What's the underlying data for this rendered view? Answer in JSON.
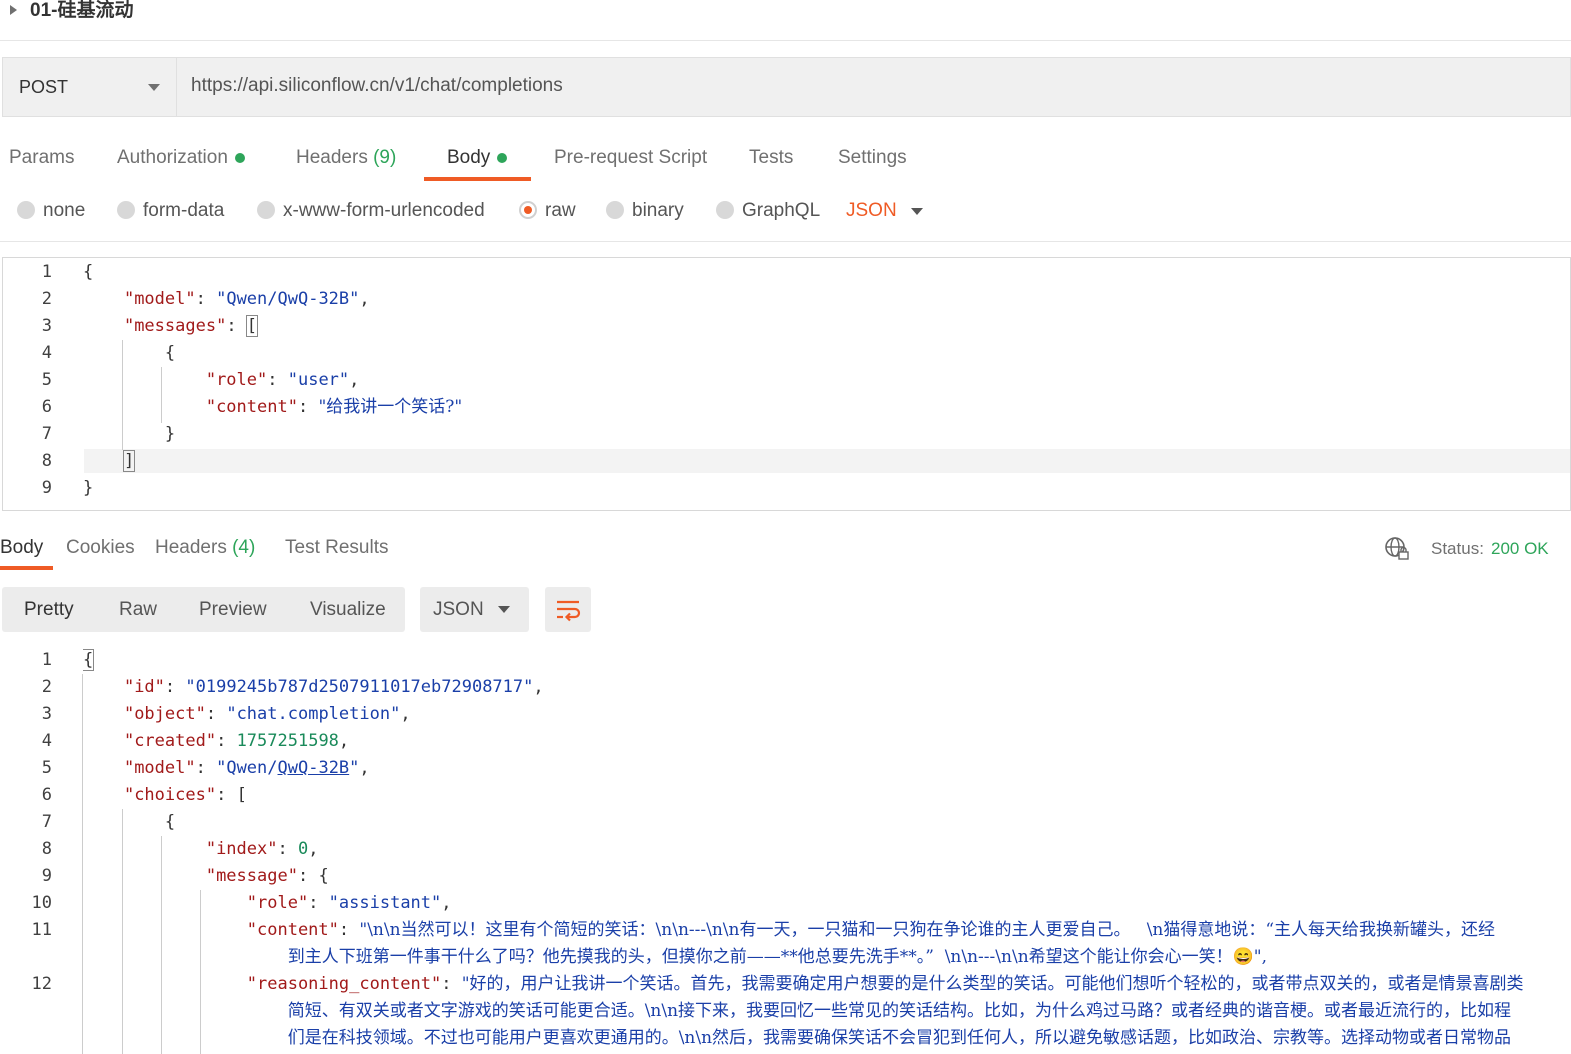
{
  "request": {
    "name": "01-硅基流动",
    "method": "POST",
    "url": "https://api.siliconflow.cn/v1/chat/completions"
  },
  "request_tabs": {
    "params": "Params",
    "authorization": "Authorization",
    "headers": "Headers",
    "headers_count": "(9)",
    "body": "Body",
    "prerequest": "Pre-request Script",
    "tests": "Tests",
    "settings": "Settings"
  },
  "body_types": {
    "none": "none",
    "form_data": "form-data",
    "urlencoded": "x-www-form-urlencoded",
    "raw": "raw",
    "binary": "binary",
    "graphql": "GraphQL",
    "selected_format": "JSON"
  },
  "request_body": {
    "line_numbers": [
      "1",
      "2",
      "3",
      "4",
      "5",
      "6",
      "7",
      "8",
      "9"
    ],
    "open_brace": "{",
    "model_key": "\"model\"",
    "model_val": "\"Qwen/QwQ-32B\"",
    "messages_key": "\"messages\"",
    "open_bracket": "[",
    "obj_open": "{",
    "role_key": "\"role\"",
    "role_val": "\"user\"",
    "content_key": "\"content\"",
    "content_val": "\"给我讲一个笑话?\"",
    "obj_close": "}",
    "close_bracket": "]",
    "close_brace": "}"
  },
  "response_tabs": {
    "body": "Body",
    "cookies": "Cookies",
    "headers": "Headers",
    "headers_count": "(4)",
    "test_results": "Test Results",
    "status_label": "Status:",
    "status_value": "200 OK"
  },
  "response_view": {
    "pretty": "Pretty",
    "raw": "Raw",
    "preview": "Preview",
    "visualize": "Visualize",
    "format": "JSON"
  },
  "response_body": {
    "line_numbers": [
      "1",
      "2",
      "3",
      "4",
      "5",
      "6",
      "7",
      "8",
      "9",
      "10",
      "11",
      "12"
    ],
    "open_brace": "{",
    "id_key": "\"id\"",
    "id_val": "\"0199245b787d2507911017eb72908717\"",
    "object_key": "\"object\"",
    "object_val": "\"chat.completion\"",
    "created_key": "\"created\"",
    "created_val": "1757251598",
    "model_key": "\"model\"",
    "model_val_a": "\"Qwen/",
    "model_val_b": "QwQ-32B",
    "model_val_c": "\"",
    "choices_key": "\"choices\"",
    "choices_open": "[",
    "obj_open": "{",
    "index_key": "\"index\"",
    "index_val": "0",
    "message_key": "\"message\"",
    "message_open": "{",
    "role_key": "\"role\"",
    "role_val": "\"assistant\"",
    "content_key": "\"content\"",
    "content_line1": "\"\\n\\n当然可以！这里有个简短的笑话：\\n\\n---\\n\\n有一天，一只猫和一只狗在争论谁的主人更爱自己。   \\n猫得意地说：“主人每天给我换新罐头，还经",
    "content_line2": "到主人下班第一件事干什么了吗？他先摸我的头，但摸你之前——**他总要先洗手**。”  \\n\\n---\\n\\n希望这个能让你会心一笑！😄\",",
    "reasoning_key": "\"reasoning_content\"",
    "reasoning_line1": "\"好的，用户让我讲一个笑话。首先，我需要确定用户想要的是什么类型的笑话。可能他们想听个轻松的，或者带点双关的，或者是情景喜剧类",
    "reasoning_line2": "简短、有双关或者文字游戏的笑话可能更合适。\\n\\n接下来，我要回忆一些常见的笑话结构。比如，为什么鸡过马路？或者经典的谐音梗。或者最近流行的，比如程",
    "reasoning_line3": "们是在科技领域。不过也可能用户更喜欢更通用的。\\n\\n然后，我需要确保笑话不会冒犯到任何人，所以避免敏感话题，比如政治、宗教等。选择动物或者日常物品"
  }
}
